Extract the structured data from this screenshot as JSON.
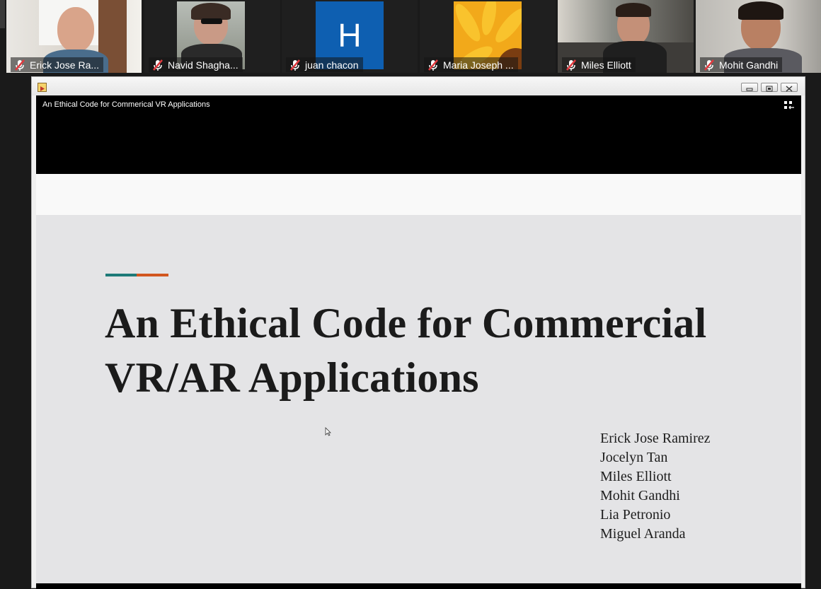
{
  "participants": [
    {
      "name": "Erick Jose Ra...",
      "avatar_icon": "video-feed",
      "muted": true
    },
    {
      "name": "Navid Shagha...",
      "avatar_icon": "video-feed",
      "muted": true
    },
    {
      "name": "juan chacon",
      "avatar_icon": "letter-avatar",
      "avatar_letter": "H",
      "avatar_color": "#0e5fb1",
      "muted": true
    },
    {
      "name": "Maria Joseph ...",
      "avatar_icon": "sunflower-image",
      "muted": true
    },
    {
      "name": "Miles Elliott",
      "avatar_icon": "video-feed",
      "muted": true
    },
    {
      "name": "Mohit Gandhi",
      "avatar_icon": "video-feed",
      "muted": true
    }
  ],
  "window": {
    "buttons": [
      "minimize-icon",
      "restore-icon",
      "close-icon"
    ]
  },
  "video": {
    "title": "An Ethical Code for Commerical VR Applications",
    "exit_icon": "exit-fullscreen-icon"
  },
  "slide": {
    "title": "An Ethical Code for Commercial VR/AR Applications",
    "accent_colors": [
      "#1d7a78",
      "#d2561f"
    ],
    "authors": [
      "Erick Jose Ramirez",
      "Jocelyn Tan",
      "Miles Elliott",
      "Mohit Gandhi",
      "Lia Petronio",
      "Miguel Aranda"
    ]
  },
  "colors": {
    "muted_icon": "#e0393e"
  }
}
